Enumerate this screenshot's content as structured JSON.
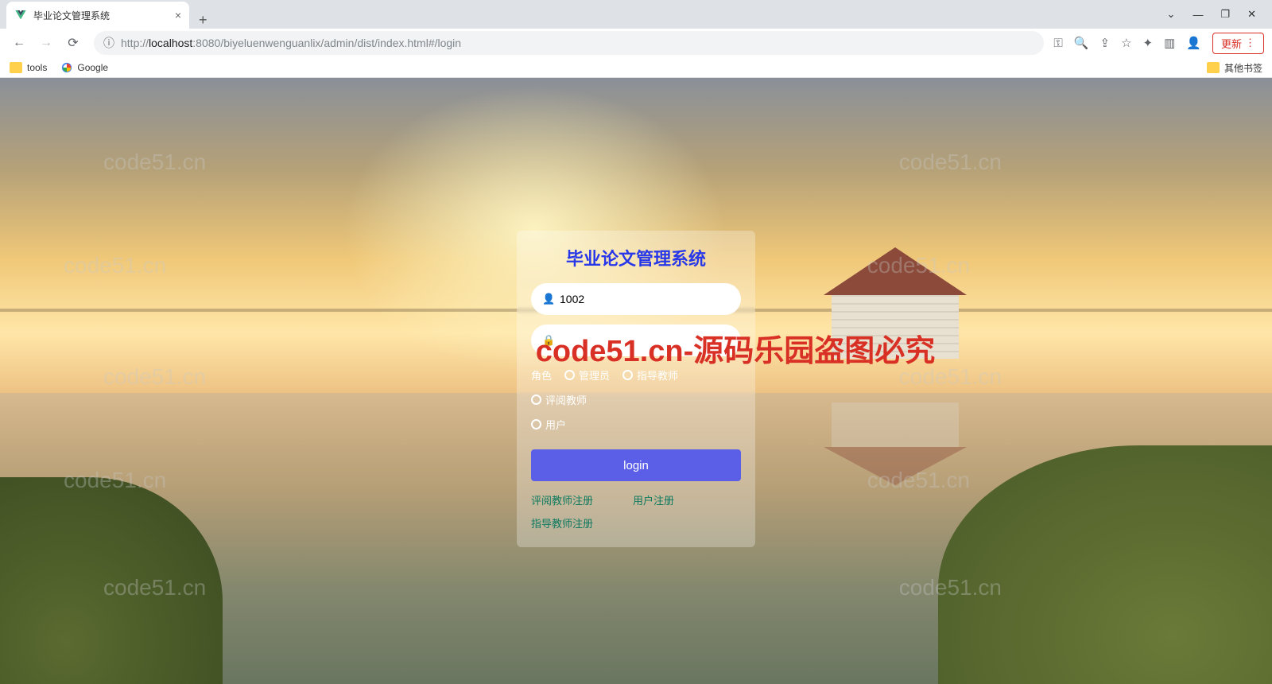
{
  "browser": {
    "tab_title": "毕业论文管理系统",
    "url_host": "localhost",
    "url_port": ":8080",
    "url_prefix": "http://",
    "url_path": "/biyeluenwenguanlix/admin/dist/index.html#/login",
    "update_label": "更新",
    "bookmarks": {
      "tools": "tools",
      "google": "Google",
      "other": "其他书签"
    }
  },
  "watermark": "code51.cn",
  "red_watermark": "code51.cn-源码乐园盗图必究",
  "login": {
    "title": "毕业论文管理系统",
    "username_value": "1002",
    "password_value": "",
    "role_label": "角色",
    "roles": {
      "admin": "管理员",
      "advisor": "指导教师",
      "reviewer": "评阅教师",
      "user": "用户"
    },
    "button": "login",
    "links": {
      "reviewer_reg": "评阅教师注册",
      "user_reg": "用户注册",
      "advisor_reg": "指导教师注册"
    }
  }
}
